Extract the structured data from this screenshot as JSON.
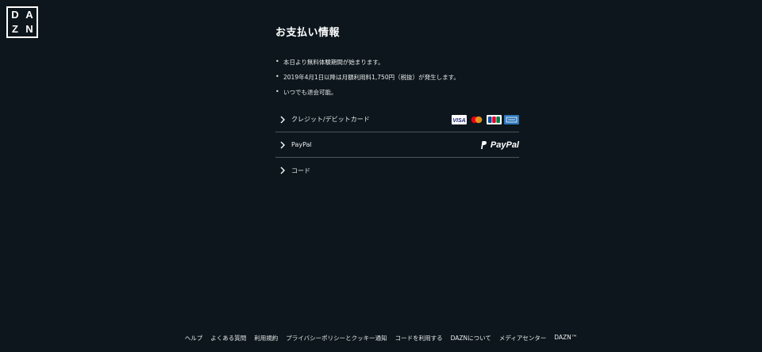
{
  "logo": {
    "l1": "D",
    "l2": "A",
    "l3": "Z",
    "l4": "N"
  },
  "title": "お支払い情報",
  "bullets": [
    "本日より無料体験期間が始まります。",
    "2019年4月1日以降は月額利用料1,750円（税抜）が発生します。",
    "いつでも退会可能。"
  ],
  "methods": [
    {
      "label": "クレジット/デビットカード",
      "icons": [
        "visa-icon",
        "mastercard-icon",
        "jcb-icon",
        "amex-icon"
      ]
    },
    {
      "label": "PayPal",
      "brand": "PayPal"
    },
    {
      "label": "コード"
    }
  ],
  "footer": [
    "ヘルプ",
    "よくある質問",
    "利用規約",
    "プライバシーポリシーとクッキー通知",
    "コードを利用する",
    "DAZNについて",
    "メディアセンター",
    "DAZN™"
  ],
  "colors": {
    "background": "#0c161c",
    "divider": "#4a5459",
    "text": "#ffffff"
  }
}
